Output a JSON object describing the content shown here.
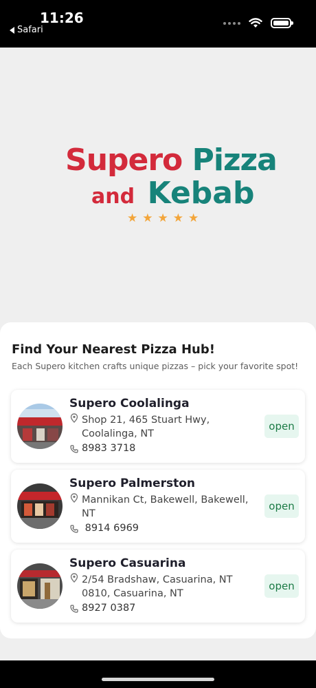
{
  "status_bar": {
    "time": "11:26",
    "back_app": "Safari",
    "icons": [
      "signal-dots-icon",
      "wifi-icon",
      "battery-icon"
    ]
  },
  "logo": {
    "line1_a": "Supero",
    "line1_b": "Pizza",
    "line2_a": "and",
    "line2_b": "Kebab",
    "stars": [
      "★",
      "★",
      "★",
      "★",
      "★"
    ]
  },
  "colors": {
    "brand_red": "#d32a3b",
    "brand_teal": "#17837a",
    "star": "#f3a53a",
    "open_badge_bg": "#e6f6ef",
    "open_badge_text": "#1b7a45"
  },
  "section": {
    "title": "Find Your Nearest Pizza Hub!",
    "subtitle": "Each Supero kitchen crafts unique pizzas – pick your favorite spot!"
  },
  "stores": [
    {
      "name": "Supero Coolalinga",
      "address": "Shop 21, 465 Stuart Hwy, Coolalinga, NT",
      "phone": "8983 3718",
      "status": "open"
    },
    {
      "name": "Supero Palmerston",
      "address": "Mannikan Ct, Bakewell, Bakewell, NT",
      "phone": " 8914 6969",
      "status": "open"
    },
    {
      "name": "Supero Casuarina",
      "address": "2/54 Bradshaw, Casuarina, NT 0810, Casuarina, NT",
      "phone": "8927 0387",
      "status": "open"
    }
  ]
}
